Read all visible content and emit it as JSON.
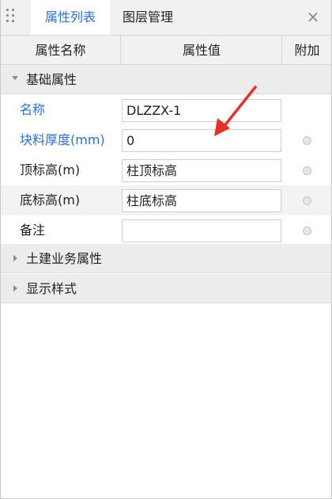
{
  "tabs": [
    {
      "label": "属性列表",
      "active": true
    },
    {
      "label": "图层管理",
      "active": false
    }
  ],
  "close_glyph": "×",
  "columns": {
    "name": "属性名称",
    "value": "属性值",
    "extra": "附加"
  },
  "groups": [
    {
      "label": "基础属性",
      "expanded": true
    },
    {
      "label": "土建业务属性",
      "expanded": false
    },
    {
      "label": "显示样式",
      "expanded": false
    }
  ],
  "properties": [
    {
      "name": "名称",
      "value": "DLZZX-1",
      "highlight": true,
      "has_extra": false
    },
    {
      "name": "块料厚度(mm)",
      "value": "0",
      "highlight": true,
      "has_extra": true
    },
    {
      "name": "顶标高(m)",
      "value": "柱顶标高",
      "highlight": false,
      "has_extra": true
    },
    {
      "name": "底标高(m)",
      "value": "柱底标高",
      "highlight": false,
      "has_extra": true
    },
    {
      "name": "备注",
      "value": "",
      "highlight": false,
      "has_extra": true
    }
  ],
  "colors": {
    "accent": "#2e6fd6",
    "annotation_arrow": "#e8302a"
  },
  "icons": {
    "grip": "grip-dots-icon",
    "close": "close-icon",
    "expand": "triangle-down-icon",
    "collapse": "triangle-right-icon",
    "radio": "radio-dot-icon"
  }
}
